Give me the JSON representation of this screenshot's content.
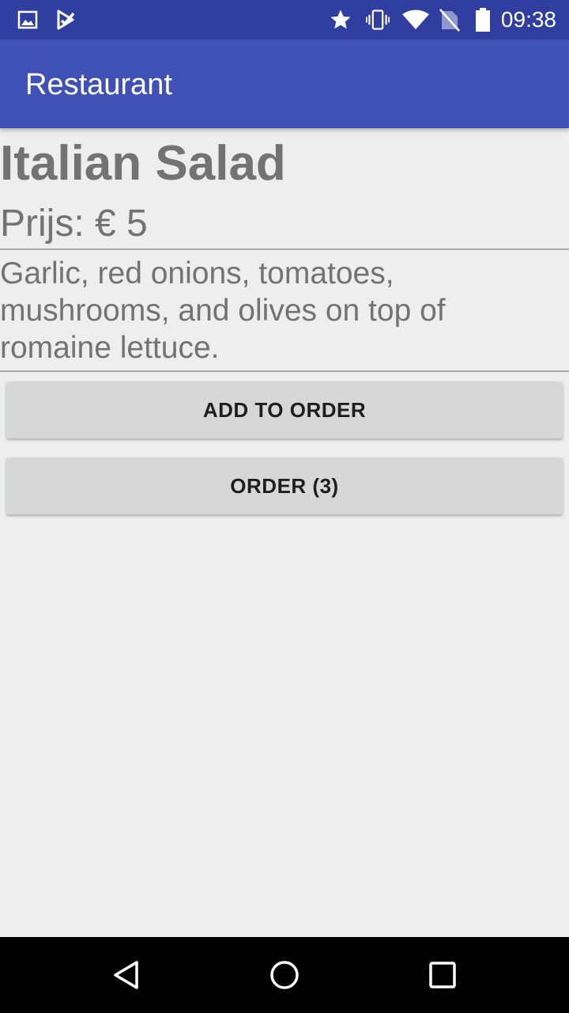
{
  "status_bar": {
    "time": "09:38",
    "icons": [
      "image-icon",
      "check-notification-icon",
      "star-icon",
      "vibrate-icon",
      "wifi-icon",
      "no-sim-icon",
      "battery-icon"
    ]
  },
  "app_bar": {
    "title": "Restaurant"
  },
  "dish": {
    "name": "Italian Salad",
    "price": "Prijs: € 5",
    "description": "Garlic, red onions, tomatoes, mushrooms, and olives on top of romaine lettuce."
  },
  "buttons": {
    "add_to_order": "ADD TO ORDER",
    "order": "ORDER (3)"
  },
  "nav_bar": {
    "icons": [
      "back-icon",
      "home-icon",
      "recents-icon"
    ]
  },
  "colors": {
    "status_bar": "#303f9f",
    "app_bar": "#3f51b5",
    "background": "#eeeeee",
    "button": "#d6d7d7",
    "text_gray": "#737373"
  }
}
